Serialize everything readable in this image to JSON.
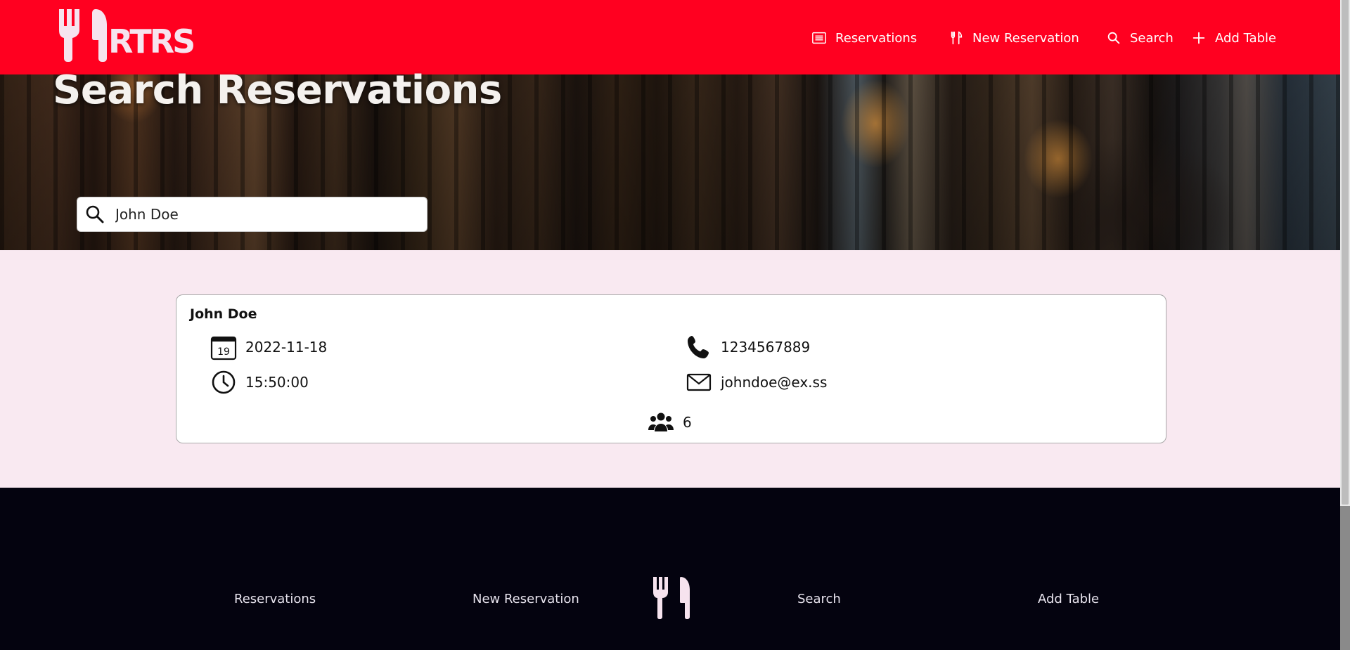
{
  "brand": {
    "logo_text": "RTRS",
    "accent": "#ff0020",
    "page_bg": "#f9e9f1",
    "footer_bg": "#04030f"
  },
  "nav": {
    "items": [
      {
        "label": "Reservations",
        "icon": "list-icon"
      },
      {
        "label": "New Reservation",
        "icon": "fork-knife-icon"
      },
      {
        "label": "Search",
        "icon": "search-icon"
      },
      {
        "label": "Add Table",
        "icon": "plus-icon"
      }
    ]
  },
  "hero": {
    "title": "Search Reservations",
    "search": {
      "value": "John Doe",
      "icon": "search-icon"
    }
  },
  "result": {
    "name": "John Doe",
    "date": "2022-11-18",
    "calendar_day": "19",
    "time": "15:50:00",
    "phone": "1234567889",
    "email": "johndoe@ex.ss",
    "party_size": "6"
  },
  "footer": {
    "links": [
      "Reservations",
      "New Reservation",
      "Search",
      "Add Table"
    ]
  }
}
